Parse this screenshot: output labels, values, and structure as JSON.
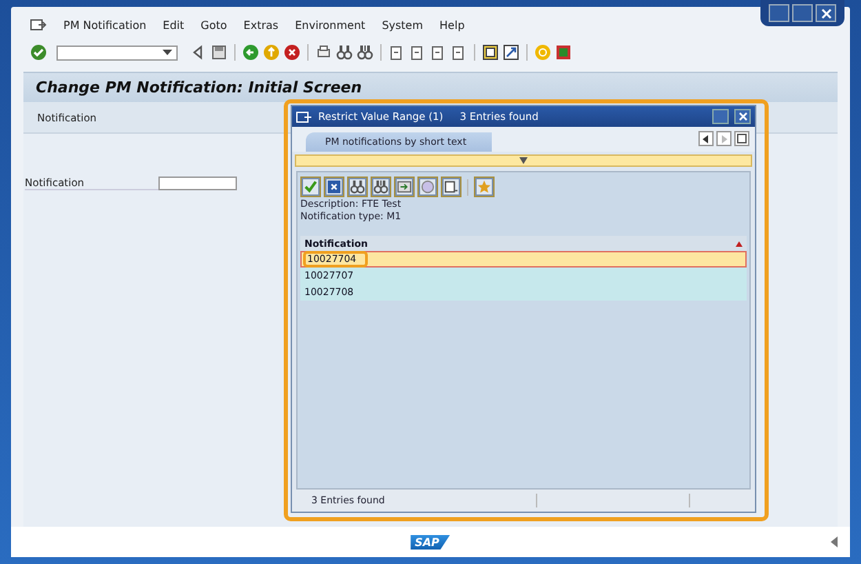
{
  "menu": [
    {
      "label": "PM Notification"
    },
    {
      "label": "Edit"
    },
    {
      "label": "Goto"
    },
    {
      "label": "Extras"
    },
    {
      "label": "Environment"
    },
    {
      "label": "System"
    },
    {
      "label": "Help"
    }
  ],
  "screen": {
    "title": "Change PM Notification: Initial Screen",
    "header_label": "Notification",
    "field_label": "Notification"
  },
  "dialog": {
    "title": "Restrict Value Range (1)",
    "title_count": "3 Entries found",
    "tab": {
      "label": "PM notifications by short text",
      "selected": true
    },
    "info": [
      "Description: FTE Test",
      "Notification type: M1"
    ],
    "column": "Notification",
    "rows": [
      {
        "value": "10027704",
        "selected": true
      },
      {
        "value": "10027707",
        "selected": false
      },
      {
        "value": "10027708",
        "selected": false
      }
    ],
    "status": "3 Entries found"
  },
  "footer": {
    "logo": "SAP"
  }
}
